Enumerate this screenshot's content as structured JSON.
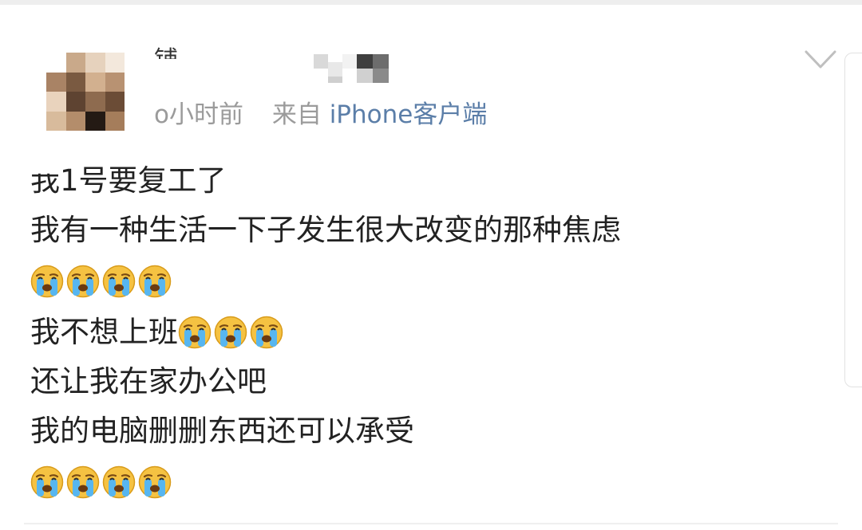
{
  "post": {
    "author_partial": "铺",
    "time": "o小时前",
    "source_prefix": "来自",
    "source_app": "iPhone客户端",
    "line1_first": "我",
    "line1_rest": "1号要复工了",
    "line2": "我有一种生活一下子发生很大改变的那种焦虑",
    "line4": "我不想上班",
    "line5": "还让我在家办公吧",
    "line6": "我的电脑删删东西还可以承受"
  },
  "icons": {
    "emoji": "crying-face-emoji",
    "menu": "chevron-down-icon",
    "avatar": "pixelated-avatar"
  },
  "colors": {
    "text": "#222222",
    "meta": "#9b9b9b",
    "source_link": "#5b7ea8",
    "emoji_face": "#f5c242",
    "tears": "#57b6f0"
  }
}
